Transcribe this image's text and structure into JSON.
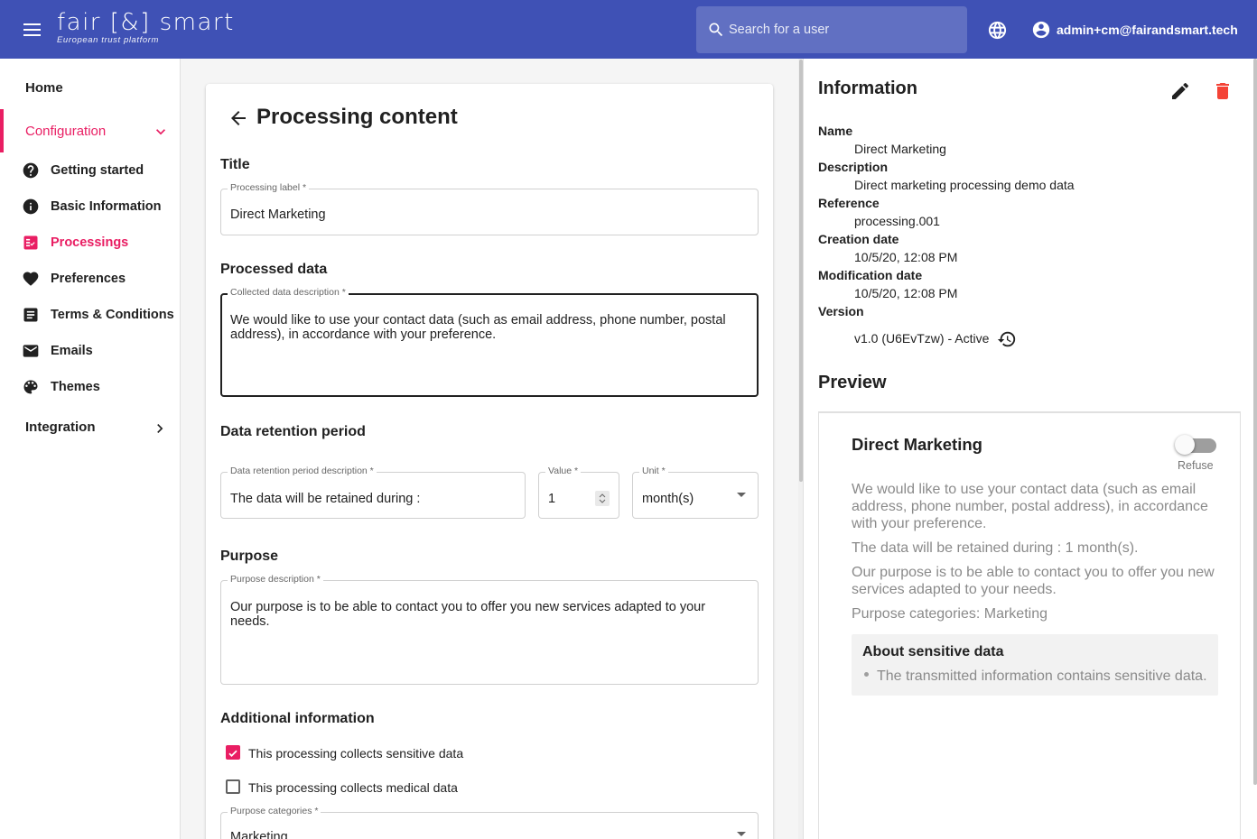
{
  "header": {
    "logo_text": "fair [&] smart",
    "logo_tagline": "European trust platform",
    "search_placeholder": "Search for a user",
    "user_email": "admin+cm@fairandsmart.tech"
  },
  "sidebar": {
    "home": "Home",
    "configuration": "Configuration",
    "items": [
      {
        "label": "Getting started",
        "icon": "help-circle-icon"
      },
      {
        "label": "Basic Information",
        "icon": "info-icon"
      },
      {
        "label": "Processings",
        "icon": "checklist-icon",
        "active": true
      },
      {
        "label": "Preferences",
        "icon": "heart-icon"
      },
      {
        "label": "Terms & Conditions",
        "icon": "document-icon"
      },
      {
        "label": "Emails",
        "icon": "mail-icon"
      },
      {
        "label": "Themes",
        "icon": "palette-icon"
      }
    ],
    "integration": "Integration"
  },
  "main": {
    "page_title": "Processing content",
    "sections": {
      "title": "Title",
      "processed_data": "Processed data",
      "retention": "Data retention period",
      "purpose": "Purpose",
      "additional": "Additional information"
    },
    "fields": {
      "processing_label": {
        "label": "Processing label *",
        "value": "Direct Marketing"
      },
      "collected_data": {
        "label": "Collected data description *",
        "value": "We would like to use your contact data (such as email address, phone number, postal address), in accordance with your preference."
      },
      "retention_desc": {
        "label": "Data retention period description *",
        "value": "The data will be retained during :"
      },
      "retention_value": {
        "label": "Value *",
        "value": "1"
      },
      "retention_unit": {
        "label": "Unit *",
        "value": "month(s)"
      },
      "purpose_desc": {
        "label": "Purpose description *",
        "value": "Our purpose is to be able to contact you to offer you new services adapted to your needs."
      },
      "purpose_categories": {
        "label": "Purpose categories *",
        "value": "Marketing"
      }
    },
    "checkboxes": {
      "sensitive": {
        "label": "This processing collects sensitive data",
        "checked": true
      },
      "medical": {
        "label": "This processing collects medical data",
        "checked": false
      }
    }
  },
  "info": {
    "title": "Information",
    "rows": [
      {
        "key": "Name",
        "value": "Direct Marketing"
      },
      {
        "key": "Description",
        "value": "Direct marketing processing demo data"
      },
      {
        "key": "Reference",
        "value": "processing.001"
      },
      {
        "key": "Creation date",
        "value": "10/5/20, 12:08 PM"
      },
      {
        "key": "Modification date",
        "value": "10/5/20, 12:08 PM"
      },
      {
        "key": "Version",
        "value": "v1.0 (U6EvTzw) - Active"
      }
    ]
  },
  "preview": {
    "title": "Preview",
    "name": "Direct Marketing",
    "toggle_label": "Refuse",
    "data_text": "We would like to use your contact data (such as email address, phone number, postal address), in accordance with your preference.",
    "retention_text": "The data will be retained during : 1 month(s).",
    "purpose_text": "Our purpose is to be able to contact you to offer you new services adapted to your needs.",
    "categories_text": "Purpose categories: Marketing",
    "sensitive_title": "About sensitive data",
    "sensitive_item": "The transmitted information contains sensitive data."
  },
  "colors": {
    "primary": "#3f51b5",
    "accent": "#e91e63",
    "delete": "#f44336"
  }
}
